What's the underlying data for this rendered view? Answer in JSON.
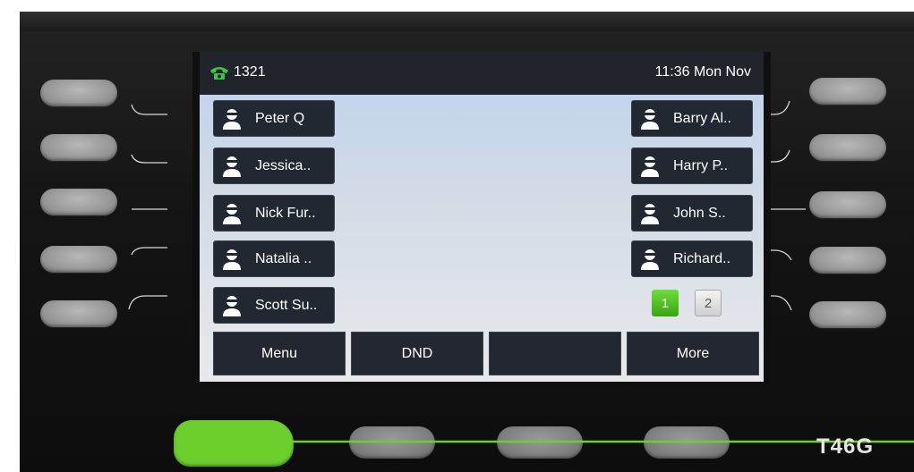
{
  "status_bar": {
    "account": "1321",
    "datetime": "11:36 Mon Nov",
    "icon": "phone-handset-icon",
    "icon_color": "#3fc14a"
  },
  "dss_keys": {
    "left": [
      {
        "label": "Peter Q",
        "icon": "contact-person-icon"
      },
      {
        "label": "Jessica..",
        "icon": "contact-person-icon"
      },
      {
        "label": "Nick Fur..",
        "icon": "contact-person-icon"
      },
      {
        "label": "Natalia ..",
        "icon": "contact-person-icon"
      },
      {
        "label": "Scott Su..",
        "icon": "contact-person-icon"
      }
    ],
    "right": [
      {
        "label": "Barry Al..",
        "icon": "contact-person-icon"
      },
      {
        "label": "Harry P..",
        "icon": "contact-person-icon"
      },
      {
        "label": "John S..",
        "icon": "contact-person-icon"
      },
      {
        "label": "Richard..",
        "icon": "contact-person-icon"
      }
    ]
  },
  "pages": {
    "items": [
      "1",
      "2"
    ],
    "active": "1",
    "active_color": "#4fc12a"
  },
  "softkeys": [
    {
      "label": "Menu"
    },
    {
      "label": "DND"
    },
    {
      "label": ""
    },
    {
      "label": "More"
    }
  ],
  "device": {
    "model": "T46G",
    "highlight_color": "#6ccf2e"
  }
}
